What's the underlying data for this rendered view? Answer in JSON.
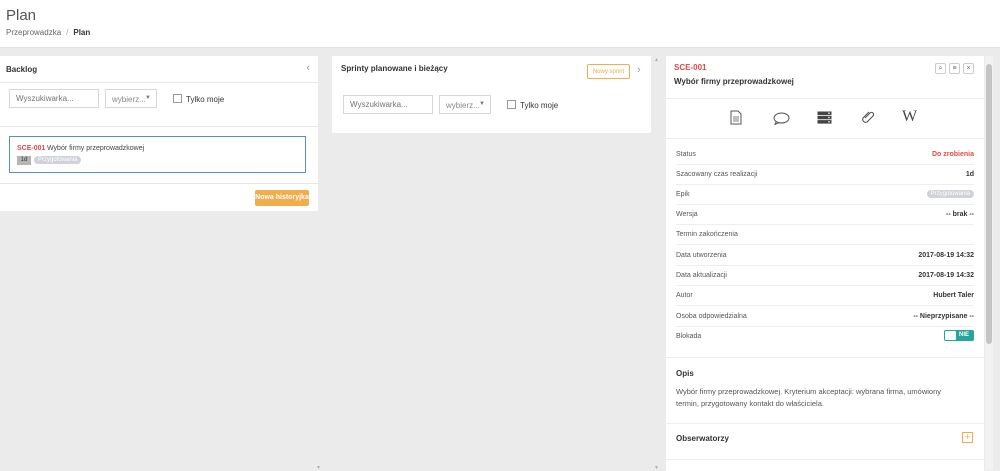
{
  "header": {
    "title": "Plan",
    "breadcrumb": {
      "parent": "Przeprowadzka",
      "separator": "/",
      "current": "Plan"
    }
  },
  "backlog": {
    "title": "Backlog",
    "search_placeholder": "Wyszukiwarka...",
    "select_value": "wybierz...",
    "only_mine_label": "Tylko moje",
    "cards": [
      {
        "code": "SCE-001",
        "name": "Wybór firmy przeprowadzkowej",
        "estimate": "1d",
        "epic": "Przygotowania"
      }
    ],
    "new_story_button": "Nowa historyjka"
  },
  "sprints": {
    "title": "Sprinty planowane i bieżący",
    "new_sprint_button": "Nowy sprint",
    "search_placeholder": "Wyszukiwarka...",
    "select_value": "wybierz...",
    "only_mine_label": "Tylko moje"
  },
  "detail": {
    "code": "SCE-001",
    "title": "Wybór firmy przeprowadzkowej",
    "tabs": [
      "document-icon",
      "comment-icon",
      "server-icon",
      "paperclip-icon",
      "wiki-icon"
    ],
    "wiki_glyph": "W",
    "fields": [
      {
        "label": "Status",
        "value": "Do zrobienia"
      },
      {
        "label": "Szacowany czas realizacji",
        "value": "1d"
      },
      {
        "label": "Epik",
        "value": "Przygotowania"
      },
      {
        "label": "Wersja",
        "value": "-- brak --"
      },
      {
        "label": "Termin zakończenia",
        "value": ""
      },
      {
        "label": "Data utworzenia",
        "value": "2017-08-19 14:32"
      },
      {
        "label": "Data aktualizacji",
        "value": "2017-08-19 14:32"
      },
      {
        "label": "Autor",
        "value": "Hubert Taler"
      },
      {
        "label": "Osoba odpowiedzialna",
        "value": "-- Nieprzypisane --"
      },
      {
        "label": "Blokada",
        "value": "NIE"
      }
    ],
    "description_title": "Opis",
    "description_text": "Wybór firmy przeprowadzkowej. Kryterium akceptacji: wybrana firma, umówiony termin, przygotowany kontakt do właściciela.",
    "watchers_title": "Obserwatorzy"
  },
  "colors": {
    "accent_orange": "#f0ad4e",
    "status_red": "#e04848",
    "toggle_green": "#26a69a",
    "card_border": "#5b8ec9"
  }
}
